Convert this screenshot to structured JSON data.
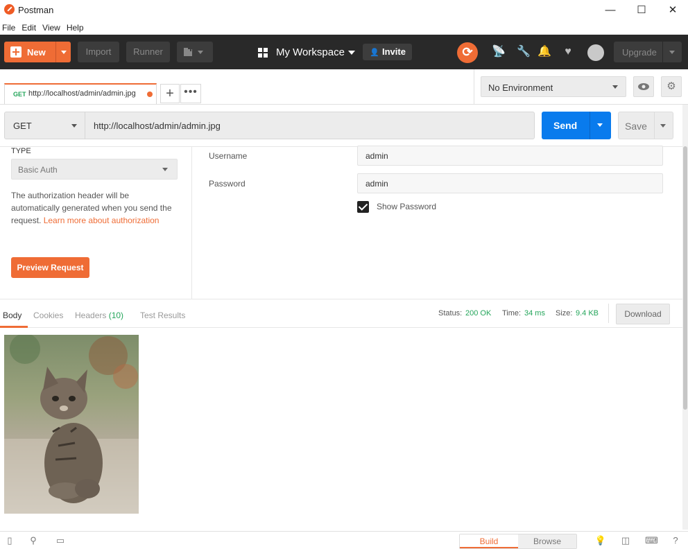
{
  "window": {
    "title": "Postman",
    "minimize": "—",
    "maximize": "☐",
    "close": "✕"
  },
  "menu": [
    "File",
    "Edit",
    "View",
    "Help"
  ],
  "header": {
    "new_label": "New",
    "import_label": "Import",
    "runner_label": "Runner",
    "workspace_label": "My Workspace",
    "invite_label": "Invite",
    "upgrade_label": "Upgrade"
  },
  "tabs": [
    {
      "method": "GET",
      "url": "http://localhost/admin/admin.jpg",
      "unsaved": true
    }
  ],
  "environment": {
    "selected": "No Environment"
  },
  "request": {
    "method": "GET",
    "url": "http://localhost/admin/admin.jpg",
    "send_label": "Send",
    "save_label": "Save"
  },
  "auth": {
    "type_label": "TYPE",
    "type_value": "Basic Auth",
    "description": "The authorization header will be automatically generated when you send the request.",
    "link_text": "Learn more about authorization",
    "preview_button": "Preview Request",
    "username_label": "Username",
    "username_value": "admin",
    "password_label": "Password",
    "password_value": "admin",
    "show_password_label": "Show Password",
    "show_password_checked": true
  },
  "response": {
    "tabs": {
      "body": "Body",
      "cookies": "Cookies",
      "headers": "Headers",
      "headers_count": "(10)",
      "test_results": "Test Results"
    },
    "status_label": "Status:",
    "status_value": "200 OK",
    "time_label": "Time:",
    "time_value": "34 ms",
    "size_label": "Size:",
    "size_value": "9.4 KB",
    "download_label": "Download"
  },
  "statusbar": {
    "build_label": "Build",
    "browse_label": "Browse"
  },
  "colors": {
    "accent": "#ef6c35",
    "send": "#097bed",
    "success": "#23a55a",
    "header_bg": "#292929"
  }
}
